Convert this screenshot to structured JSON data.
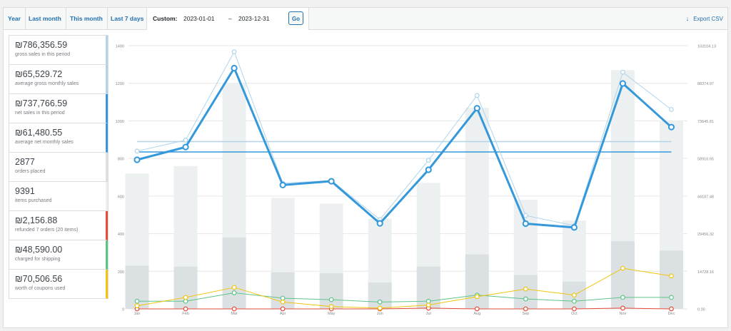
{
  "tabs": [
    {
      "label": "Year"
    },
    {
      "label": "Last month"
    },
    {
      "label": "This month"
    },
    {
      "label": "Last 7 days"
    }
  ],
  "custom": {
    "label": "Custom:",
    "from": "2023-01-01",
    "dash": "–",
    "to": "2023-12-31",
    "go_label": "Go"
  },
  "export": {
    "icon": "download-arrow-icon",
    "label": "Export CSV"
  },
  "legend": [
    {
      "value": "₪786,356.59",
      "sub": "gross sales in this period",
      "color": "#b1d4ea"
    },
    {
      "value": "₪65,529.72",
      "sub": "average gross monthly sales",
      "color": "#b1d4ea"
    },
    {
      "value": "₪737,766.59",
      "sub": "net sales in this period",
      "color": "#3498db"
    },
    {
      "value": "₪61,480.55",
      "sub": "average net monthly sales",
      "color": "#3498db"
    },
    {
      "value": "2877",
      "sub": "orders placed",
      "color": "#dbe1e3"
    },
    {
      "value": "9391",
      "sub": "items purchased",
      "color": "#ecf0f1"
    },
    {
      "value": "₪2,156.88",
      "sub": "refunded 7 orders (20 items)",
      "color": "#e74c3c"
    },
    {
      "value": "₪48,590.00",
      "sub": "charged for shipping",
      "color": "#5cc488"
    },
    {
      "value": "₪70,506.56",
      "sub": "worth of coupons used",
      "color": "#f1c40f"
    }
  ],
  "chart_data": {
    "type": "bar+line",
    "categories": [
      "Jan",
      "Feb",
      "Mar",
      "Apr",
      "May",
      "Jun",
      "Jul",
      "Aug",
      "Sep",
      "Oct",
      "Nov",
      "Dec"
    ],
    "left_axis": {
      "ticks": [
        "0",
        "200",
        "400",
        "600",
        "800",
        "1000",
        "1200",
        "1400"
      ],
      "range": [
        0,
        1400
      ]
    },
    "right_axis": {
      "ticks": [
        "0.00",
        "14728.16",
        "29456.32",
        "44187.48",
        "58916.65",
        "73645.81",
        "88374.97",
        "103104.13"
      ],
      "range": [
        0,
        103104.13
      ]
    },
    "items_purchased": [
      720,
      760,
      1200,
      590,
      560,
      480,
      670,
      1070,
      580,
      470,
      1270,
      1000
    ],
    "orders_placed": [
      230,
      225,
      380,
      195,
      190,
      140,
      225,
      290,
      180,
      145,
      360,
      310
    ],
    "gross_sales": [
      61800,
      66100,
      100700,
      49200,
      50300,
      35000,
      58200,
      83600,
      36600,
      32600,
      92700,
      78100
    ],
    "net_sales": [
      58400,
      63400,
      94300,
      48500,
      50000,
      33500,
      54500,
      78600,
      33400,
      31900,
      88300,
      71200
    ],
    "shipping": [
      3000,
      3000,
      6300,
      4200,
      3600,
      2700,
      3000,
      5400,
      3900,
      3000,
      4500,
      4500
    ],
    "coupons": [
      1200,
      4500,
      8400,
      2700,
      900,
      300,
      1500,
      4800,
      7800,
      5400,
      15900,
      12900
    ],
    "refunds": [
      0,
      0,
      0,
      0,
      0,
      0,
      300,
      0,
      0,
      0,
      300,
      0
    ],
    "avg_gross": 65529.72,
    "avg_net": 61480.55
  }
}
